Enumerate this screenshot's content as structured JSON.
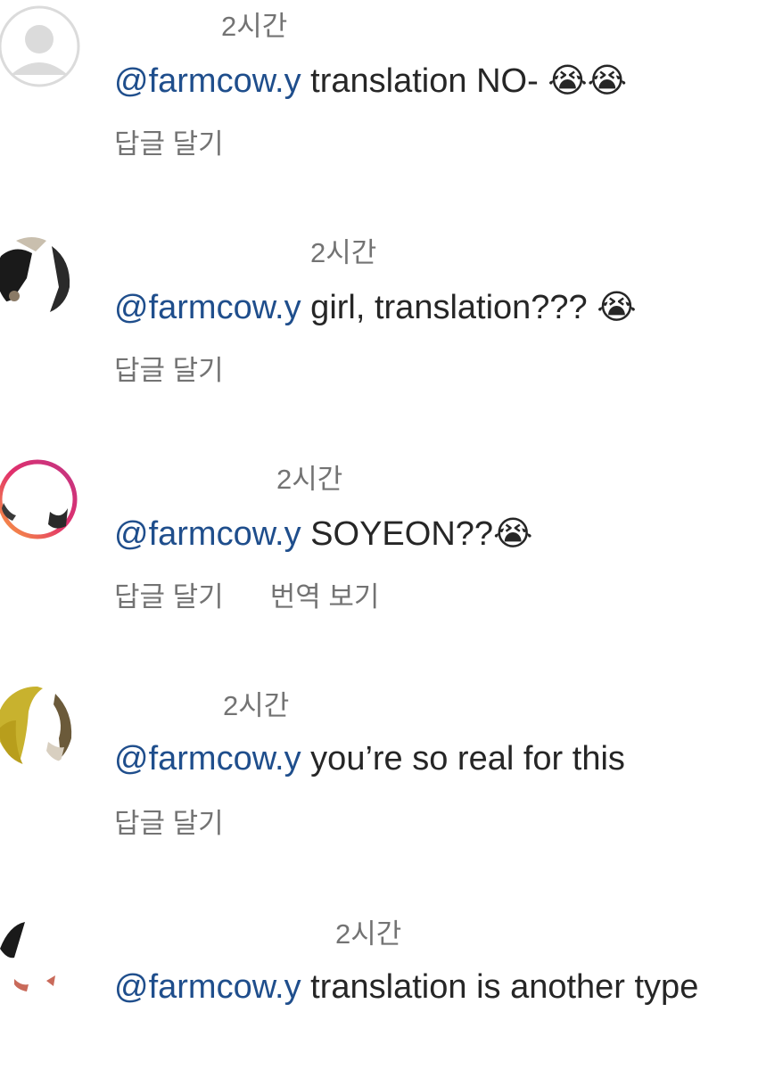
{
  "comments": [
    {
      "time": "2시간",
      "mention": "@farmcow.y",
      "text": " translation NO- ",
      "emoji": "😭😭",
      "reply_label": "답글 달기"
    },
    {
      "time": "2시간",
      "mention": "@farmcow.y",
      "text": " girl, translation??? ",
      "emoji": "😭",
      "reply_label": "답글 달기"
    },
    {
      "time": "2시간",
      "mention": "@farmcow.y",
      "text": " SOYEON??",
      "emoji": "😭",
      "reply_label": "답글 달기",
      "translate_label": "번역 보기"
    },
    {
      "time": "2시간",
      "mention": "@farmcow.y",
      "text": " you’re so real for this",
      "emoji": "",
      "reply_label": "답글 달기"
    },
    {
      "time": "2시간",
      "mention": "@farmcow.y",
      "text": " translation is another type",
      "emoji": ""
    }
  ],
  "avatar_icons": [
    "default-profile-icon",
    "profile-photo",
    "profile-photo-story-ring",
    "profile-photo",
    "profile-photo"
  ],
  "colors": {
    "mention": "#1f4e8c",
    "text": "#262626",
    "meta": "#737373"
  }
}
